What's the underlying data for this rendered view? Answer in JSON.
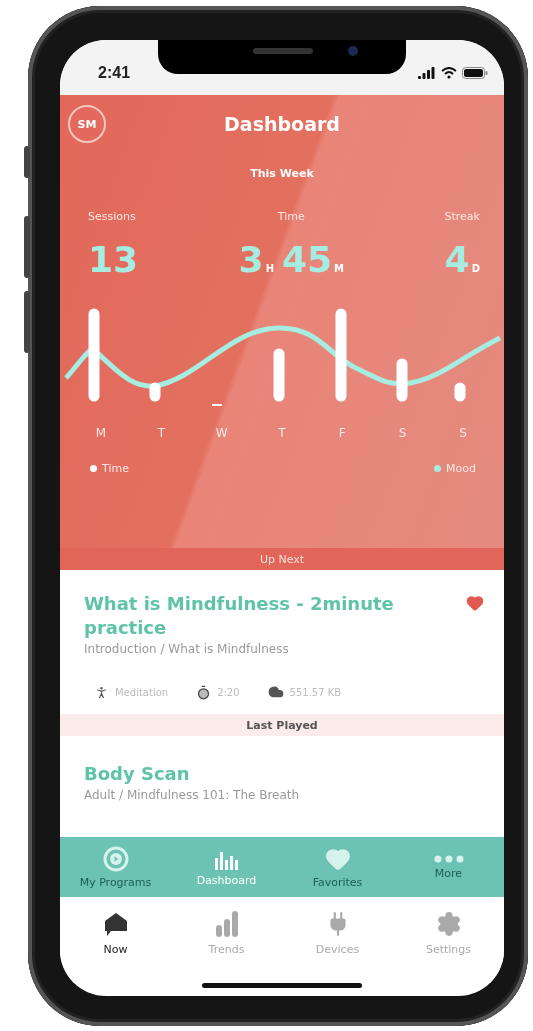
{
  "status_bar": {
    "time": "2:41"
  },
  "header": {
    "avatar": "SM",
    "title": "Dashboard",
    "period": "This Week"
  },
  "stats": [
    {
      "label": "Sessions",
      "parts": [
        {
          "value": "13"
        }
      ]
    },
    {
      "label": "Time",
      "parts": [
        {
          "value": "3",
          "unit": "H"
        },
        {
          "value": "45",
          "unit": "M"
        }
      ]
    },
    {
      "label": "Streak",
      "parts": [
        {
          "value": "4",
          "unit": "D"
        }
      ]
    }
  ],
  "days": [
    "M",
    "T",
    "W",
    "T",
    "F",
    "S",
    "S"
  ],
  "legend": [
    {
      "label": "Time",
      "color": "#ffffff"
    },
    {
      "label": "Mood",
      "color": "#a6ece0"
    }
  ],
  "up_next": {
    "heading": "Up Next",
    "title": "What is Mindfulness - 2minute practice",
    "path": "Introduction / What is Mindfulness",
    "favorite": true,
    "meta": [
      {
        "kind": "type",
        "text": "Meditation"
      },
      {
        "kind": "duration",
        "text": "2:20"
      },
      {
        "kind": "size",
        "text": "551.57 KB"
      }
    ]
  },
  "last_played": {
    "heading": "Last Played",
    "title": "Body Scan",
    "path": "Adult / Mindfulness 101: The Breath"
  },
  "app_nav": [
    {
      "kind": "programs",
      "label": "My Programs",
      "selected": false
    },
    {
      "kind": "dashboard",
      "label": "Dashboard",
      "selected": true
    },
    {
      "kind": "favorites",
      "label": "Favorites",
      "selected": false
    },
    {
      "kind": "more",
      "label": "More",
      "selected": false
    }
  ],
  "tab_bar": [
    {
      "kind": "now",
      "label": "Now",
      "selected": true
    },
    {
      "kind": "trends",
      "label": "Trends",
      "selected": false
    },
    {
      "kind": "devices",
      "label": "Devices",
      "selected": false
    },
    {
      "kind": "settings",
      "label": "Settings",
      "selected": false
    }
  ]
}
